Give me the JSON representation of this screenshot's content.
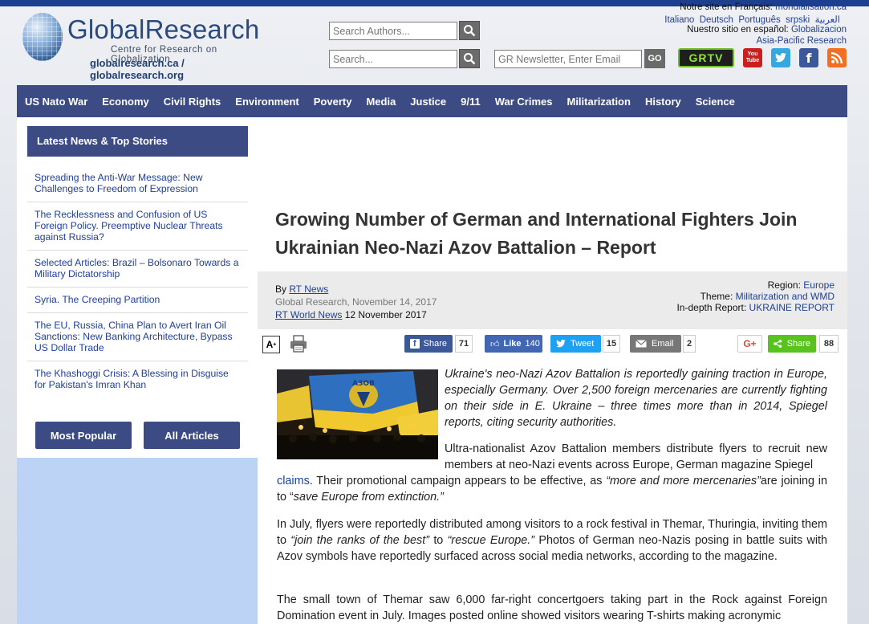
{
  "header": {
    "brand": "GlobalResearch",
    "tagline": "Centre for Research on Globalization",
    "urls": "globalresearch.ca / globalresearch.org",
    "search_authors_placeholder": "Search Authors...",
    "search_placeholder": "Search...",
    "newsletter_placeholder": "GR Newsletter, Enter Email",
    "go_label": "GO",
    "lang_fr_prefix": "Notre site en Français:",
    "lang_fr_link": "mondialisation.ca",
    "lang_links": [
      "Italiano",
      "Deutsch",
      "Português",
      "srpski",
      "العربية"
    ],
    "lang_es_prefix": "Nuestro sitio en español:",
    "lang_es_link": "Globalizacion",
    "asia_link": "Asia-Pacific Research",
    "grtv_label": "GRTV",
    "youtube_label": "You Tube"
  },
  "nav": {
    "items": [
      "US Nato War",
      "Economy",
      "Civil Rights",
      "Environment",
      "Poverty",
      "Media",
      "Justice",
      "9/11",
      "War Crimes",
      "Militarization",
      "History",
      "Science"
    ]
  },
  "sidebar": {
    "heading": "Latest News & Top Stories",
    "items": [
      "Spreading the Anti-War Message: New Challenges to Freedom of Expression",
      "The Recklessness and Confusion of US Foreign Policy. Preemptive Nuclear Threats against Russia?",
      "Selected Articles: Brazil – Bolsonaro Towards a Military Dictatorship",
      "Syria. The Creeping Partition",
      "The EU, Russia, China Plan to Avert Iran Oil Sanctions: New Banking Architecture, Bypass US Dollar Trade",
      "The Khashoggi Crisis: A Blessing in Disguise for Pakistan's Imran Khan"
    ],
    "most_popular": "Most Popular",
    "all_articles": "All Articles"
  },
  "article": {
    "title": "Growing Number of German and International Fighters Join Ukrainian Neo-Nazi Azov Battalion – Report",
    "by": "By",
    "author": "RT News",
    "source_date": "Global Research, November 14, 2017",
    "origin_link": "RT World News",
    "origin_date": "12 November 2017",
    "region_label": "Region:",
    "region": "Europe",
    "theme_label": "Theme:",
    "theme": "Militarization and WMD",
    "indepth_label": "In-depth Report:",
    "indepth": "UKRAINE REPORT",
    "image_banner_text": "АЗОВ",
    "lead": "Ukraine's neo-Nazi Azov Battalion is reportedly gaining traction in Europe, especially Germany. Over 2,500 foreign mercenaries are currently fighting on their side in E. Ukraine – three times more than in 2014, Spiegel reports, citing security authorities.",
    "p1_a": "Ultra-nationalist Azov Battalion members distribute flyers to recruit new members at neo-Nazi events across Europe, German magazine Spiegel",
    "p1_link": "claims",
    "p1_b": ". Their promotional campaign appears to be effective, as",
    "p1_quote1": "“more and more mercenaries”",
    "p1_c": "are joining in to “",
    "p1_quote2": "save Europe from extinction.”",
    "p2_a": "In July, flyers were reportedly distributed among visitors to a rock festival in Themar, Thuringia, inviting them to",
    "p2_quote1": "“join the ranks of the best”",
    "p2_b": "to",
    "p2_quote2": "“rescue Europe.”",
    "p2_c": "Photos of German neo-Nazis posing in battle suits with Azov symbols have reportedly surfaced across social media networks, according to the magazine.",
    "p3": "The small town of Themar saw 6,000 far-right concertgoers taking part in the Rock against Foreign Domination event in July. Images posted online showed visitors wearing T-shirts making acronymic"
  },
  "share": {
    "fb_label": "Share",
    "fb_count": "71",
    "like_label": "Like",
    "like_count": "140",
    "tweet_label": "Tweet",
    "tweet_count": "15",
    "email_label": "Email",
    "email_count": "2",
    "gplus_label": "G+",
    "share_label": "Share",
    "share_count": "88",
    "font_size_label": "A"
  },
  "colors": {
    "nav_bg": "#3c4b84",
    "link": "#1f3f9a",
    "facebook": "#3b5998",
    "twitter": "#1da1f2",
    "email": "#777777",
    "gplus": "#dd4b39",
    "sharethis": "#58c21f",
    "sidebar_bg": "#bcd3f5"
  }
}
